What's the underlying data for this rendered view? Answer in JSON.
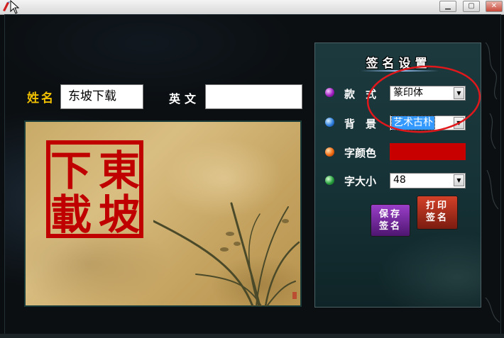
{
  "form": {
    "name_label": "姓名",
    "name_value": "东坡下载",
    "english_label": "英文",
    "english_value": ""
  },
  "seal": {
    "chars": [
      "東",
      "坡",
      "下",
      "載"
    ],
    "color": "#c00000"
  },
  "panel": {
    "title": "签名设置",
    "style_label": "款　式",
    "style_value": "篆印体",
    "background_label": "背　景",
    "background_value": "艺术古朴",
    "font_color_label": "字颜色",
    "font_color_value": "#c80000",
    "font_size_label": "字大小",
    "font_size_value": "48",
    "save_label": "保存签名",
    "print_label": "打印签名"
  },
  "colors": {
    "label_yellow": "#f0c000",
    "annotation_red": "#e0181c"
  }
}
